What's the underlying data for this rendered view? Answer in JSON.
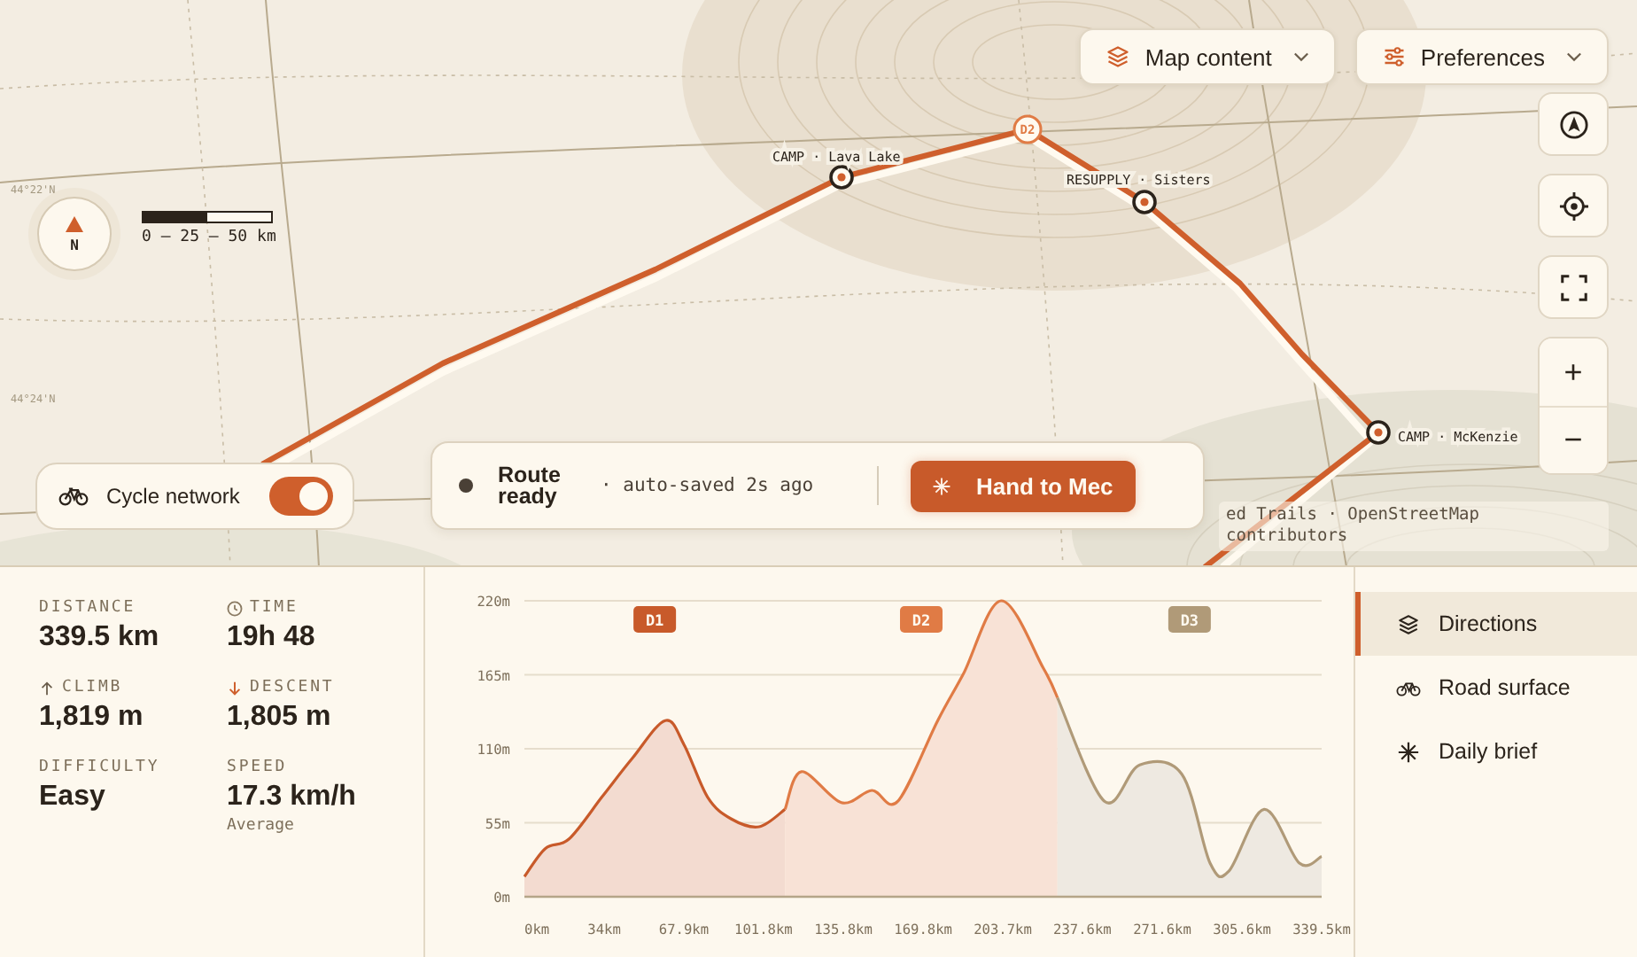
{
  "map": {
    "latitude_labels": [
      "44°22'N",
      "44°24'N"
    ],
    "compass": {
      "label": "N"
    },
    "scale": {
      "label": "0 — 25 — 50 km",
      "level": 0.5
    },
    "waypoints": [
      {
        "label": "CAMP · Lava Lake"
      },
      {
        "label": "RESUPPLY · Sisters"
      },
      {
        "label": "CAMP · McKenzie"
      }
    ],
    "day_markers": [
      {
        "label": "D2"
      }
    ],
    "dropdowns": [
      {
        "label": "Map content",
        "kind": "layers"
      },
      {
        "label": "Preferences",
        "kind": "sliders"
      }
    ],
    "tools": [
      {
        "kind": "navigate"
      },
      {
        "kind": "locate"
      },
      {
        "kind": "fullscreen"
      }
    ],
    "zoom": {
      "in": "+",
      "out": "−"
    },
    "layer_toggle": {
      "label": "Cycle network",
      "on": true
    },
    "status": {
      "title": "Route ready",
      "note": "· auto-saved 2s ago",
      "button": "Hand to Mec"
    },
    "attribution": "ed Trails · OpenStreetMap contributors"
  },
  "stats": [
    {
      "label": "DISTANCE",
      "value": "339.5 km"
    },
    {
      "label": "TIME",
      "value": "19h 48",
      "kind": "clock"
    },
    {
      "label": "CLIMB",
      "value": "1,819 m",
      "kind": "up"
    },
    {
      "label": "DESCENT",
      "value": "1,805 m",
      "kind": "down"
    },
    {
      "label": "DIFFICULTY",
      "value": "Easy"
    },
    {
      "label": "SPEED",
      "value": "17.3 km/h",
      "note": "Average"
    }
  ],
  "elevation": {
    "chart_data": {
      "type": "area",
      "x": [
        0,
        9,
        19,
        33,
        46,
        60,
        68,
        78,
        88,
        100,
        111,
        118,
        135,
        148,
        159,
        176,
        187,
        203,
        221,
        227,
        247,
        262,
        280,
        292,
        300,
        315,
        330,
        339.5
      ],
      "series": [
        {
          "name": "D1",
          "color": "#c85a2a",
          "values": [
            15,
            36,
            43,
            74,
            103,
            131,
            113,
            74,
            58,
            52,
            65,
            null,
            null,
            null,
            null,
            null,
            null,
            null,
            null,
            null,
            null,
            null,
            null,
            null,
            null,
            null,
            null,
            null
          ]
        },
        {
          "name": "D2",
          "color": "#e07b45",
          "values": [
            null,
            null,
            null,
            null,
            null,
            null,
            null,
            null,
            null,
            null,
            65,
            93,
            70,
            79,
            71,
            131,
            166,
            220,
            170,
            148,
            null,
            null,
            null,
            null,
            null,
            null,
            null,
            null
          ]
        },
        {
          "name": "D3",
          "color": "#b09a78",
          "values": [
            null,
            null,
            null,
            null,
            null,
            null,
            null,
            null,
            null,
            null,
            null,
            null,
            null,
            null,
            null,
            null,
            null,
            null,
            null,
            148,
            71,
            98,
            91,
            25,
            19,
            65,
            25,
            30
          ]
        }
      ],
      "xlim": [
        0,
        339.5
      ],
      "ylim": [
        0,
        220
      ],
      "grid": true,
      "xticks": [
        {
          "value": 0,
          "label": "0km"
        },
        {
          "value": 34,
          "label": "34km"
        },
        {
          "value": 67.9,
          "label": "67.9km"
        },
        {
          "value": 101.8,
          "label": "101.8km"
        },
        {
          "value": 135.8,
          "label": "135.8km"
        },
        {
          "value": 169.8,
          "label": "169.8km"
        },
        {
          "value": 203.7,
          "label": "203.7km"
        },
        {
          "value": 237.6,
          "label": "237.6km"
        },
        {
          "value": 271.6,
          "label": "271.6km"
        },
        {
          "value": 305.6,
          "label": "305.6km"
        },
        {
          "value": 339.5,
          "label": "339.5km"
        }
      ],
      "yticks": [
        {
          "value": 0,
          "label": "0m"
        },
        {
          "value": 55,
          "label": "55m"
        },
        {
          "value": 110,
          "label": "110m"
        },
        {
          "value": 165,
          "label": "165m"
        },
        {
          "value": 220,
          "label": "220m"
        }
      ]
    }
  },
  "sidebar": {
    "items": [
      {
        "label": "Directions",
        "kind": "layers",
        "selected": true
      },
      {
        "label": "Road surface",
        "kind": "bike",
        "selected": false
      },
      {
        "label": "Daily brief",
        "kind": "sparkle",
        "selected": false
      }
    ]
  }
}
